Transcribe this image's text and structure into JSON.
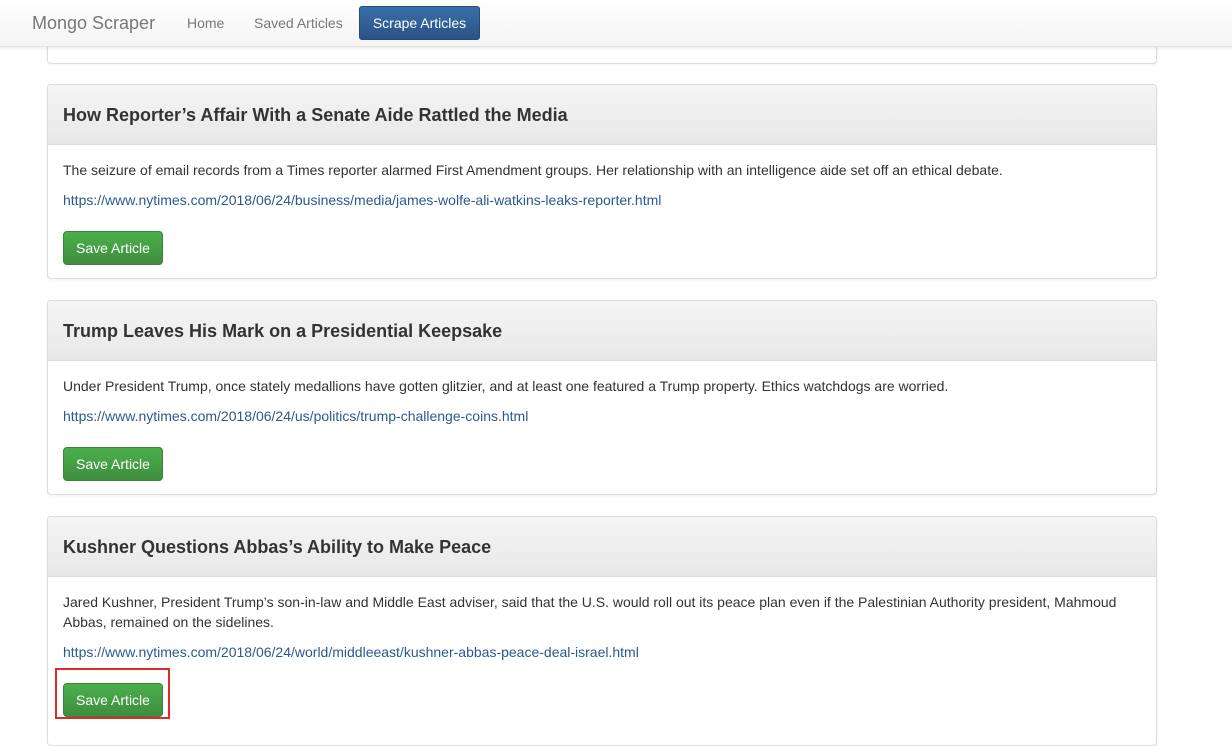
{
  "nav": {
    "brand": "Mongo Scraper",
    "home": "Home",
    "saved": "Saved Articles",
    "scrape": "Scrape Articles"
  },
  "articles": [
    {
      "title": "How Reporter’s Affair With a Senate Aide Rattled the Media",
      "summary": "The seizure of email records from a Times reporter alarmed First Amendment groups. Her relationship with an intelligence aide set off an ethical debate.",
      "url": "https://www.nytimes.com/2018/06/24/business/media/james-wolfe-ali-watkins-leaks-reporter.html",
      "button": "Save Article"
    },
    {
      "title": "Trump Leaves His Mark on a Presidential Keepsake",
      "summary": "Under President Trump, once stately medallions have gotten glitzier, and at least one featured a Trump property. Ethics watchdogs are worried.",
      "url": "https://www.nytimes.com/2018/06/24/us/politics/trump-challenge-coins.html",
      "button": "Save Article"
    },
    {
      "title": "Kushner Questions Abbas’s Ability to Make Peace",
      "summary": "Jared Kushner, President Trump’s son-in-law and Middle East adviser, said that the U.S. would roll out its peace plan even if the Palestinian Authority president, Mahmoud Abbas, remained on the sidelines.",
      "url": "https://www.nytimes.com/2018/06/24/world/middleeast/kushner-abbas-peace-deal-israel.html",
      "button": "Save Article"
    }
  ],
  "colors": {
    "highlight": "#e02a2a",
    "save_button": "#449d44",
    "nav_active": "#2f5f96"
  }
}
